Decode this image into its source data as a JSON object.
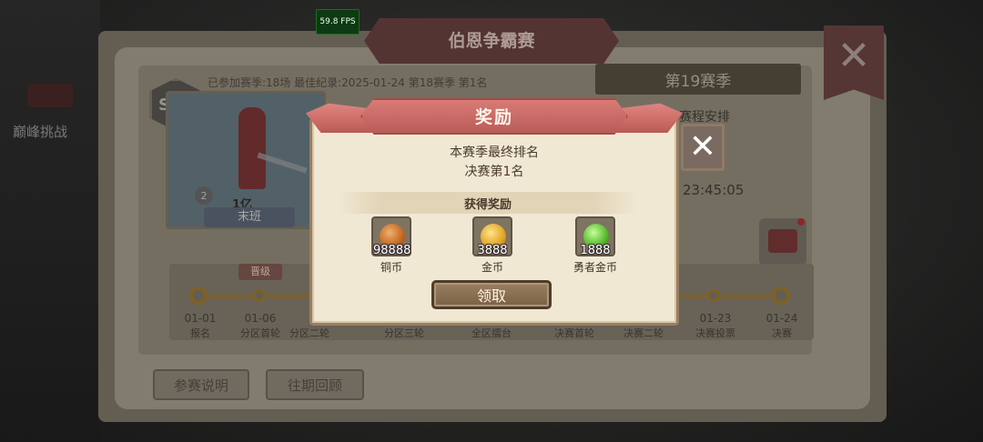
{
  "fps": "59.8 FPS",
  "side": {
    "label": "巅峰挑战"
  },
  "main": {
    "title": "伯恩争霸赛",
    "close_icon": "close-icon",
    "season_badge": "S18",
    "season_info": "已参加赛季:18场 最佳纪录:2025-01-24 第18赛季 第1名",
    "hero": {
      "level": "2",
      "power": "1亿",
      "name": "末班"
    },
    "season_tag": "第19赛季",
    "schedule_label": "赛程安排",
    "countdown": "23:45:05",
    "timeline": {
      "promotion_badge": "晋级",
      "stages": [
        {
          "date": "01-01",
          "name": "报名"
        },
        {
          "date": "01-06",
          "name": "分区首轮"
        },
        {
          "date": "",
          "name": "分区二轮"
        },
        {
          "date": "",
          "name": "分区三轮"
        },
        {
          "date": "",
          "name": "全区擂台"
        },
        {
          "date": "",
          "name": "决赛首轮"
        },
        {
          "date": "",
          "name": "决赛二轮"
        },
        {
          "date": "01-23",
          "name": "决赛投票"
        },
        {
          "date": "01-24",
          "name": "决赛"
        }
      ]
    },
    "buttons": {
      "rules": "参赛说明",
      "history": "往期回顾"
    }
  },
  "dialog": {
    "title": "奖励",
    "close_icon": "close-icon",
    "line1": "本赛季最终排名",
    "line2": "决赛第1名",
    "rewards_label": "获得奖励",
    "rewards": [
      {
        "icon": "bronze-coin-icon",
        "qty": "98888",
        "name": "铜币"
      },
      {
        "icon": "gold-coin-icon",
        "qty": "3888",
        "name": "金币"
      },
      {
        "icon": "hero-coin-icon",
        "qty": "1888",
        "name": "勇者金币"
      }
    ],
    "claim_label": "领取"
  },
  "colors": {
    "dialog_bg": "#f1e8d4",
    "title_banner": "#cf6e69",
    "claim_button": "#7a6046"
  }
}
